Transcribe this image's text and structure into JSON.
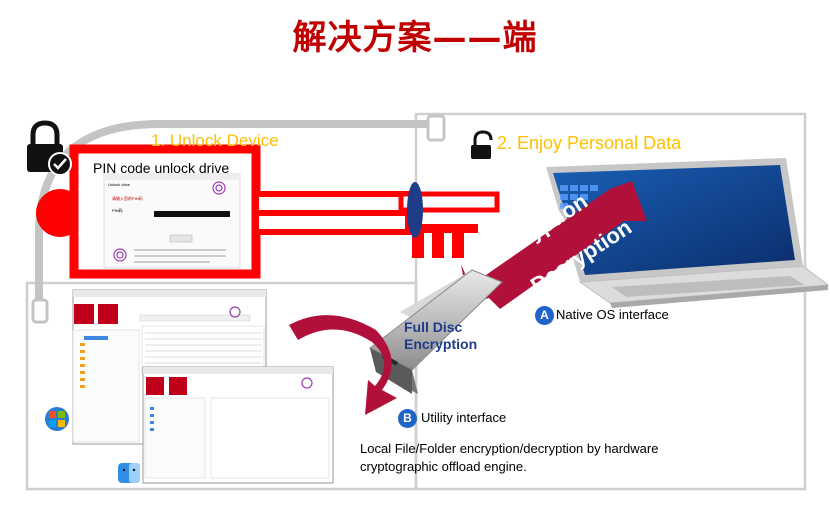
{
  "title": "解决方案——端",
  "step1_label": "1. Unlock Device",
  "step2_label": "2. Enjoy Personal Data",
  "pin_dialog_title": "PIN code unlock drive",
  "arrow_encryption": "Encryption",
  "arrow_decryption": "Decryption",
  "drive_label_line1": "Full Disc",
  "drive_label_line2": "Encryption",
  "interface_a_badge": "A",
  "interface_a_label": "Native OS interface",
  "interface_b_badge": "B",
  "interface_b_label": "Utility interface",
  "description": "Local File/Folder encryption/decryption by hardware cryptographic offload engine.",
  "colors": {
    "title": "#c00000",
    "step_text": "#ffc000",
    "key_red": "#ff0000",
    "arrow_red": "#b0103a",
    "badge_blue": "#1f64c8",
    "drive_text": "#1f3c88"
  },
  "icons": [
    "lock-check-icon",
    "unlocked-padlock-icon",
    "windows-logo-icon",
    "mac-finder-icon",
    "fingerprint-icon"
  ]
}
